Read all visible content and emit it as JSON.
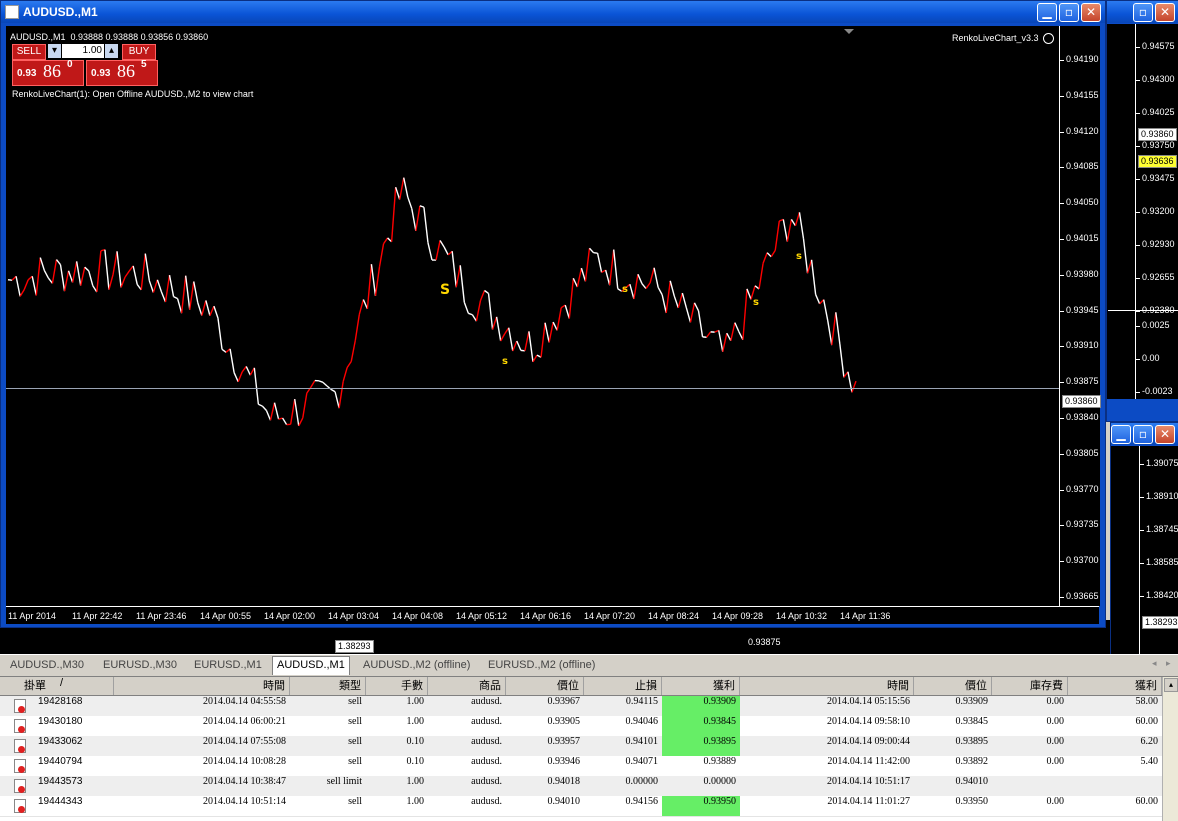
{
  "window": {
    "title": "AUDUSD.,M1",
    "symbol_line": "AUDUSD.,M1  0.93888 0.93888 0.93856 0.93860",
    "indicator_label": "RenkoLiveChart_v3.3",
    "comment": "RenkoLiveChart(1): Open Offline AUDUSD.,M2 to view chart",
    "current_price": "0.93860"
  },
  "trade_panel": {
    "sell_label": "SELL",
    "buy_label": "BUY",
    "lot": "1.00",
    "sell_price_small": "0.93",
    "sell_price_big": "86",
    "sell_price_sup": "0",
    "buy_price_small": "0.93",
    "buy_price_big": "86",
    "buy_price_sup": "5"
  },
  "y_axis": [
    "0.94190",
    "0.94155",
    "0.94120",
    "0.94085",
    "0.94050",
    "0.94015",
    "0.93980",
    "0.93945",
    "0.93910",
    "0.93875",
    "0.93840",
    "0.93805",
    "0.93770",
    "0.93735",
    "0.93700",
    "0.93665"
  ],
  "x_axis": [
    "11 Apr 2014",
    "11 Apr 22:42",
    "11 Apr 23:46",
    "14 Apr 00:55",
    "14 Apr 02:00",
    "14 Apr 03:04",
    "14 Apr 04:08",
    "14 Apr 05:12",
    "14 Apr 06:16",
    "14 Apr 07:20",
    "14 Apr 08:24",
    "14 Apr 09:28",
    "14 Apr 10:32",
    "14 Apr 11:36"
  ],
  "markers": [
    "S",
    "s",
    "s",
    "s",
    "s"
  ],
  "chart_data": {
    "type": "line",
    "x": [
      "11 Apr 2014",
      "11 Apr 22:42",
      "11 Apr 23:46",
      "14 Apr 00:55",
      "14 Apr 02:00",
      "14 Apr 03:04",
      "14 Apr 04:08",
      "14 Apr 05:12",
      "14 Apr 06:16",
      "14 Apr 07:20",
      "14 Apr 08:24",
      "14 Apr 09:28",
      "14 Apr 10:32",
      "14 Apr 11:36"
    ],
    "series": [
      {
        "values": [
          0.93965,
          0.93975,
          0.9397,
          0.9394,
          0.9383,
          0.93855,
          0.9405,
          0.93955,
          0.939,
          0.93985,
          0.93955,
          0.9389,
          0.9403,
          0.9386
        ]
      }
    ],
    "ylim": [
      0.9365,
      0.9421
    ],
    "current_price": 0.9386,
    "grid": false
  },
  "right_window": {
    "axis1": [
      "0.94575",
      "0.94300",
      "0.94025",
      "0.93750",
      "0.93475",
      "0.93200",
      "0.92930",
      "0.92655",
      "0.92380"
    ],
    "box1a": "0.93860",
    "box1b": "0.93636",
    "axis2": [
      "0.0025",
      "0.00",
      "-0.0023"
    ],
    "axis3": [
      "1.39075",
      "1.38910",
      "1.38745",
      "1.38585",
      "1.38420"
    ],
    "box3": "1.38293"
  },
  "behind": {
    "label_a": "1.38293",
    "label_b": "0.93875"
  },
  "tabs": [
    "AUDUSD.,M30",
    "EURUSD.,M30",
    "EURUSD.,M1",
    "AUDUSD.,M1",
    "AUDUSD.,M2 (offline)",
    "EURUSD.,M2 (offline)"
  ],
  "active_tab": 3,
  "table": {
    "headers": [
      "掛單",
      "/",
      "時間",
      "類型",
      "手數",
      "商品",
      "價位",
      "止損",
      "獲利",
      "時間",
      "價位",
      "庫存費",
      "獲利"
    ],
    "rows": [
      [
        "19428168",
        "2014.04.14 04:55:58",
        "sell",
        "1.00",
        "audusd.",
        "0.93967",
        "0.94115",
        "0.93909",
        "2014.04.14 05:15:56",
        "0.93909",
        "0.00",
        "58.00"
      ],
      [
        "19430180",
        "2014.04.14 06:00:21",
        "sell",
        "1.00",
        "audusd.",
        "0.93905",
        "0.94046",
        "0.93845",
        "2014.04.14 09:58:10",
        "0.93845",
        "0.00",
        "60.00"
      ],
      [
        "19433062",
        "2014.04.14 07:55:08",
        "sell",
        "0.10",
        "audusd.",
        "0.93957",
        "0.94101",
        "0.93895",
        "2014.04.14 09:00:44",
        "0.93895",
        "0.00",
        "6.20"
      ],
      [
        "19440794",
        "2014.04.14 10:08:28",
        "sell",
        "0.10",
        "audusd.",
        "0.93946",
        "0.94071",
        "0.93889",
        "2014.04.14 11:42:00",
        "0.93892",
        "0.00",
        "5.40"
      ],
      [
        "19443573",
        "2014.04.14 10:38:47",
        "sell limit",
        "1.00",
        "audusd.",
        "0.94018",
        "0.00000",
        "0.00000",
        "2014.04.14 10:51:17",
        "0.94010",
        "",
        ""
      ],
      [
        "19444343",
        "2014.04.14 10:51:14",
        "sell",
        "1.00",
        "audusd.",
        "0.94010",
        "0.94156",
        "0.93950",
        "2014.04.14 11:01:27",
        "0.93950",
        "0.00",
        "60.00"
      ]
    ],
    "highlight_tp": [
      true,
      true,
      true,
      false,
      false,
      true
    ],
    "highlight_color": "#66ee66"
  },
  "colors": {
    "bull": "#ff0000",
    "bear": "#ffffff",
    "marker": "#ffd700",
    "title_blue": "#0a54d6"
  }
}
